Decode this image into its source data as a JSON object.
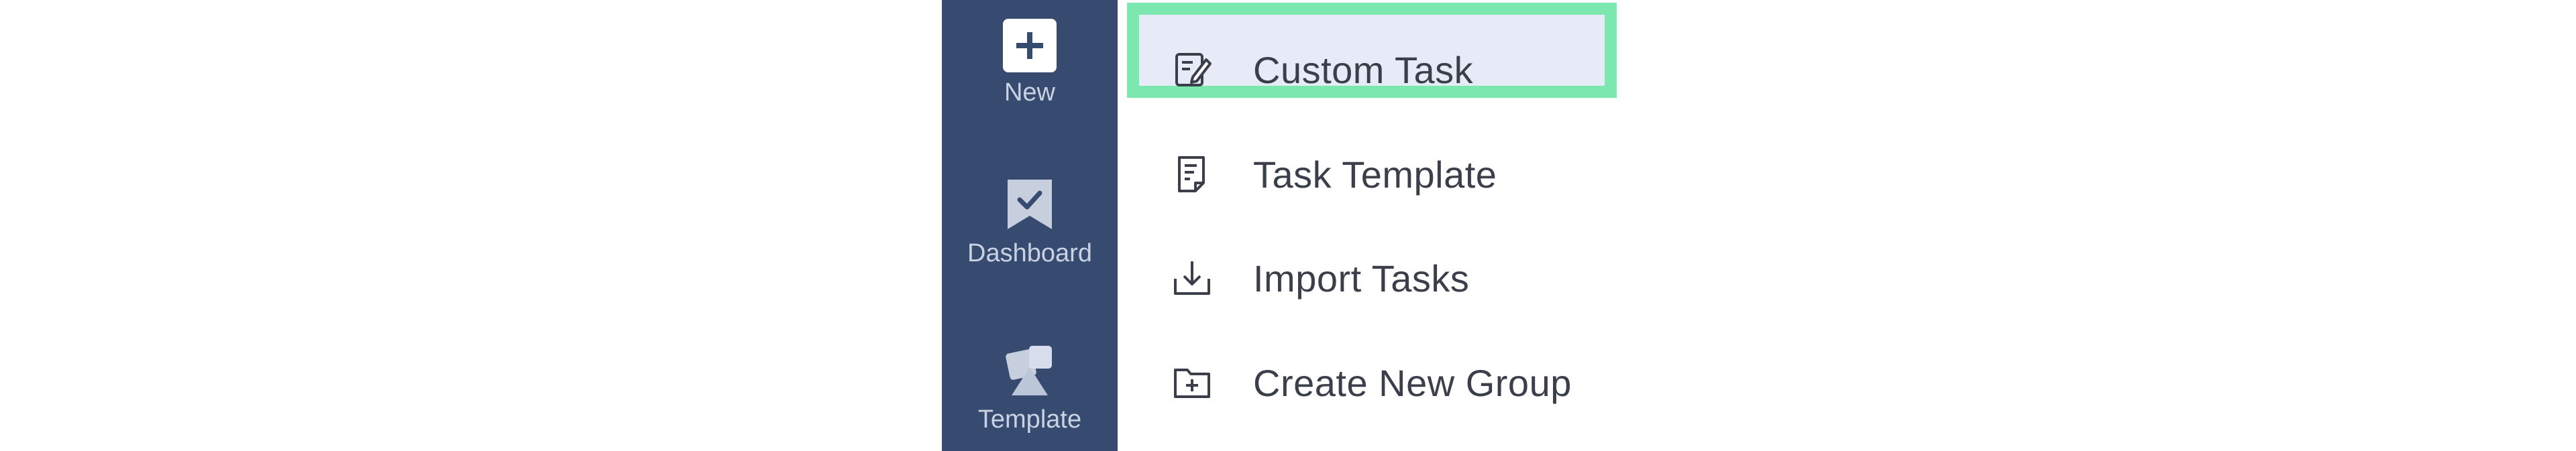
{
  "nav": {
    "new_label": "New",
    "dashboard_label": "Dashboard",
    "template_label": "Template"
  },
  "menu": {
    "items": [
      {
        "label": "Custom Task",
        "icon": "edit-note-icon",
        "highlighted": true
      },
      {
        "label": "Task Template",
        "icon": "document-icon",
        "highlighted": false
      },
      {
        "label": "Import Tasks",
        "icon": "download-tray-icon",
        "highlighted": false
      },
      {
        "label": "Create New Group",
        "icon": "folder-plus-icon",
        "highlighted": false
      }
    ]
  },
  "colors": {
    "nav_background": "#364b6f",
    "highlight_fill": "#e6ebf7",
    "highlight_border": "#7ce8b0",
    "text": "#3a3f4a"
  }
}
